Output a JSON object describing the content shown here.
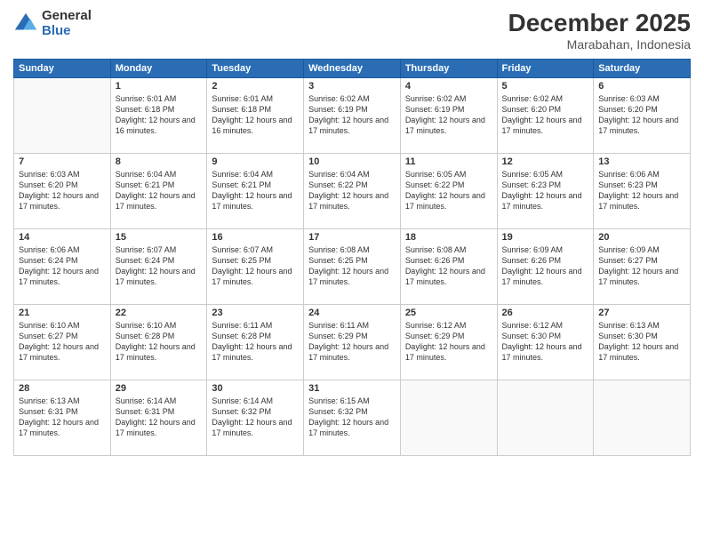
{
  "logo": {
    "general": "General",
    "blue": "Blue"
  },
  "header": {
    "month": "December 2025",
    "location": "Marabahan, Indonesia"
  },
  "weekdays": [
    "Sunday",
    "Monday",
    "Tuesday",
    "Wednesday",
    "Thursday",
    "Friday",
    "Saturday"
  ],
  "weeks": [
    [
      {
        "day": "",
        "empty": true
      },
      {
        "day": "1",
        "sunrise": "6:01 AM",
        "sunset": "6:18 PM",
        "daylight": "12 hours and 16 minutes."
      },
      {
        "day": "2",
        "sunrise": "6:01 AM",
        "sunset": "6:18 PM",
        "daylight": "12 hours and 16 minutes."
      },
      {
        "day": "3",
        "sunrise": "6:02 AM",
        "sunset": "6:19 PM",
        "daylight": "12 hours and 17 minutes."
      },
      {
        "day": "4",
        "sunrise": "6:02 AM",
        "sunset": "6:19 PM",
        "daylight": "12 hours and 17 minutes."
      },
      {
        "day": "5",
        "sunrise": "6:02 AM",
        "sunset": "6:20 PM",
        "daylight": "12 hours and 17 minutes."
      },
      {
        "day": "6",
        "sunrise": "6:03 AM",
        "sunset": "6:20 PM",
        "daylight": "12 hours and 17 minutes."
      }
    ],
    [
      {
        "day": "7",
        "sunrise": "6:03 AM",
        "sunset": "6:20 PM",
        "daylight": "12 hours and 17 minutes."
      },
      {
        "day": "8",
        "sunrise": "6:04 AM",
        "sunset": "6:21 PM",
        "daylight": "12 hours and 17 minutes."
      },
      {
        "day": "9",
        "sunrise": "6:04 AM",
        "sunset": "6:21 PM",
        "daylight": "12 hours and 17 minutes."
      },
      {
        "day": "10",
        "sunrise": "6:04 AM",
        "sunset": "6:22 PM",
        "daylight": "12 hours and 17 minutes."
      },
      {
        "day": "11",
        "sunrise": "6:05 AM",
        "sunset": "6:22 PM",
        "daylight": "12 hours and 17 minutes."
      },
      {
        "day": "12",
        "sunrise": "6:05 AM",
        "sunset": "6:23 PM",
        "daylight": "12 hours and 17 minutes."
      },
      {
        "day": "13",
        "sunrise": "6:06 AM",
        "sunset": "6:23 PM",
        "daylight": "12 hours and 17 minutes."
      }
    ],
    [
      {
        "day": "14",
        "sunrise": "6:06 AM",
        "sunset": "6:24 PM",
        "daylight": "12 hours and 17 minutes."
      },
      {
        "day": "15",
        "sunrise": "6:07 AM",
        "sunset": "6:24 PM",
        "daylight": "12 hours and 17 minutes."
      },
      {
        "day": "16",
        "sunrise": "6:07 AM",
        "sunset": "6:25 PM",
        "daylight": "12 hours and 17 minutes."
      },
      {
        "day": "17",
        "sunrise": "6:08 AM",
        "sunset": "6:25 PM",
        "daylight": "12 hours and 17 minutes."
      },
      {
        "day": "18",
        "sunrise": "6:08 AM",
        "sunset": "6:26 PM",
        "daylight": "12 hours and 17 minutes."
      },
      {
        "day": "19",
        "sunrise": "6:09 AM",
        "sunset": "6:26 PM",
        "daylight": "12 hours and 17 minutes."
      },
      {
        "day": "20",
        "sunrise": "6:09 AM",
        "sunset": "6:27 PM",
        "daylight": "12 hours and 17 minutes."
      }
    ],
    [
      {
        "day": "21",
        "sunrise": "6:10 AM",
        "sunset": "6:27 PM",
        "daylight": "12 hours and 17 minutes."
      },
      {
        "day": "22",
        "sunrise": "6:10 AM",
        "sunset": "6:28 PM",
        "daylight": "12 hours and 17 minutes."
      },
      {
        "day": "23",
        "sunrise": "6:11 AM",
        "sunset": "6:28 PM",
        "daylight": "12 hours and 17 minutes."
      },
      {
        "day": "24",
        "sunrise": "6:11 AM",
        "sunset": "6:29 PM",
        "daylight": "12 hours and 17 minutes."
      },
      {
        "day": "25",
        "sunrise": "6:12 AM",
        "sunset": "6:29 PM",
        "daylight": "12 hours and 17 minutes."
      },
      {
        "day": "26",
        "sunrise": "6:12 AM",
        "sunset": "6:30 PM",
        "daylight": "12 hours and 17 minutes."
      },
      {
        "day": "27",
        "sunrise": "6:13 AM",
        "sunset": "6:30 PM",
        "daylight": "12 hours and 17 minutes."
      }
    ],
    [
      {
        "day": "28",
        "sunrise": "6:13 AM",
        "sunset": "6:31 PM",
        "daylight": "12 hours and 17 minutes."
      },
      {
        "day": "29",
        "sunrise": "6:14 AM",
        "sunset": "6:31 PM",
        "daylight": "12 hours and 17 minutes."
      },
      {
        "day": "30",
        "sunrise": "6:14 AM",
        "sunset": "6:32 PM",
        "daylight": "12 hours and 17 minutes."
      },
      {
        "day": "31",
        "sunrise": "6:15 AM",
        "sunset": "6:32 PM",
        "daylight": "12 hours and 17 minutes."
      },
      {
        "day": "",
        "empty": true
      },
      {
        "day": "",
        "empty": true
      },
      {
        "day": "",
        "empty": true
      }
    ]
  ]
}
